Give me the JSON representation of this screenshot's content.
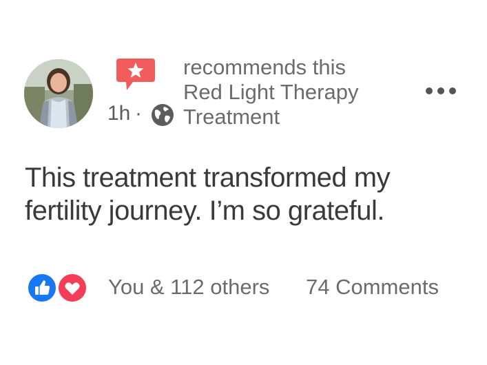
{
  "post": {
    "author_avatar_icon": "user-avatar-photo",
    "badge_icon": "recommend-star-icon",
    "badge_color": "#f25c5c",
    "time": "1h",
    "separator": "·",
    "audience_icon": "globe-icon",
    "recommendation_line1": "recommends this",
    "recommendation_line2": "Red Light Therapy",
    "recommendation_line3": "Treatment",
    "more_icon": "more-options-icon",
    "body": "This treatment transformed my fertility journey. I’m so grateful."
  },
  "footer": {
    "reaction_icons": [
      "like-icon",
      "love-icon"
    ],
    "like_color": "#1877f2",
    "love_color": "#f33e58",
    "reaction_text": "You & 112 others",
    "comments_text": "74 Comments"
  }
}
